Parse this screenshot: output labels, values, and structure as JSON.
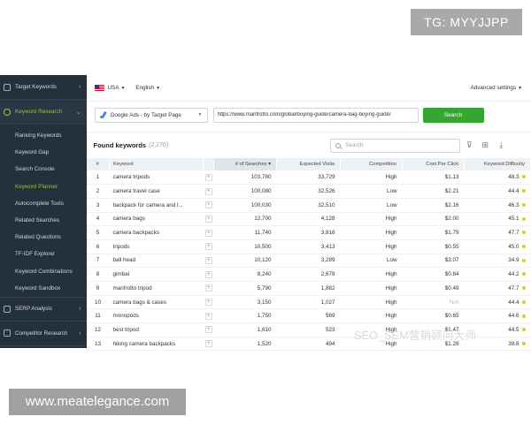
{
  "overlay": {
    "tg_label": "TG: MYYJJPP",
    "site_label": "www.meatelegance.com",
    "watermark": "SEO_SEM营销顾问大师"
  },
  "sidebar": {
    "sections": [
      {
        "label": "Target Keywords",
        "chevron": "›"
      },
      {
        "label": "Keyword Research",
        "chevron": "⌄"
      }
    ],
    "items": [
      {
        "label": "Ranking Keywords"
      },
      {
        "label": "Keyword Gap"
      },
      {
        "label": "Search Console"
      },
      {
        "label": "Keyword Planner"
      },
      {
        "label": "Autocomplete Tools"
      },
      {
        "label": "Related Searches"
      },
      {
        "label": "Related Questions"
      },
      {
        "label": "TF-IDF Explorer"
      },
      {
        "label": "Keyword Combinations"
      },
      {
        "label": "Keyword Sandbox"
      }
    ],
    "bottom_sections": [
      {
        "label": "SERP Analysis",
        "chevron": "›"
      },
      {
        "label": "Competitor Research",
        "chevron": "›"
      }
    ]
  },
  "topbar": {
    "country": "USA",
    "language": "English",
    "advanced_settings": "Advanced settings"
  },
  "search": {
    "source": "Google Ads - by Target Page",
    "url": "https://www.manfrotto.com/global/buying-guide/camera-bag-buying-guide/",
    "button": "Search"
  },
  "results": {
    "title": "Found keywords",
    "count": "(2,276)",
    "search_placeholder": "Search"
  },
  "table": {
    "headers": [
      "#",
      "Keyword",
      "",
      "# of Searches ▾",
      "Expected Visits",
      "Competition",
      "Cost Per Click",
      "Keyword Difficulty"
    ],
    "rows": [
      {
        "n": "1",
        "keyword": "camera tripods",
        "searches": "103,780",
        "visits": "33,729",
        "competition": "High",
        "cpc": "$1.13",
        "difficulty": "48.3"
      },
      {
        "n": "2",
        "keyword": "camera travel case",
        "searches": "100,080",
        "visits": "32,526",
        "competition": "Low",
        "cpc": "$2.21",
        "difficulty": "44.4"
      },
      {
        "n": "3",
        "keyword": "backpack for camera and l...",
        "searches": "100,030",
        "visits": "32,510",
        "competition": "Low",
        "cpc": "$2.16",
        "difficulty": "46.3"
      },
      {
        "n": "4",
        "keyword": "camera bags",
        "searches": "12,700",
        "visits": "4,128",
        "competition": "High",
        "cpc": "$2.00",
        "difficulty": "45.1"
      },
      {
        "n": "5",
        "keyword": "camera backpacks",
        "searches": "11,740",
        "visits": "3,816",
        "competition": "High",
        "cpc": "$1.79",
        "difficulty": "47.7"
      },
      {
        "n": "6",
        "keyword": "tripods",
        "searches": "10,500",
        "visits": "3,413",
        "competition": "High",
        "cpc": "$0.55",
        "difficulty": "45.0"
      },
      {
        "n": "7",
        "keyword": "ball head",
        "searches": "10,120",
        "visits": "3,289",
        "competition": "Low",
        "cpc": "$3.07",
        "difficulty": "34.9"
      },
      {
        "n": "8",
        "keyword": "gimbal",
        "searches": "8,240",
        "visits": "2,678",
        "competition": "High",
        "cpc": "$0.84",
        "difficulty": "44.2"
      },
      {
        "n": "9",
        "keyword": "manfrotto tripod",
        "searches": "5,790",
        "visits": "1,882",
        "competition": "High",
        "cpc": "$0.49",
        "difficulty": "47.7"
      },
      {
        "n": "10",
        "keyword": "camera bags & cases",
        "searches": "3,150",
        "visits": "1,027",
        "competition": "High",
        "cpc": "N/A",
        "difficulty": "44.4"
      },
      {
        "n": "11",
        "keyword": "monopods",
        "searches": "1,750",
        "visits": "569",
        "competition": "High",
        "cpc": "$0.65",
        "difficulty": "44.6"
      },
      {
        "n": "12",
        "keyword": "best tripod",
        "searches": "1,610",
        "visits": "523",
        "competition": "High",
        "cpc": "$1.47",
        "difficulty": "44.5"
      },
      {
        "n": "13",
        "keyword": "hiking camera backpacks",
        "searches": "1,520",
        "visits": "494",
        "competition": "High",
        "cpc": "$1.28",
        "difficulty": "39.8"
      }
    ]
  },
  "colors": {
    "sidebar_bg": "#25303d",
    "accent_green": "#37a532",
    "active_text": "#8ec63f",
    "difficulty_dot": "#f0c419"
  }
}
